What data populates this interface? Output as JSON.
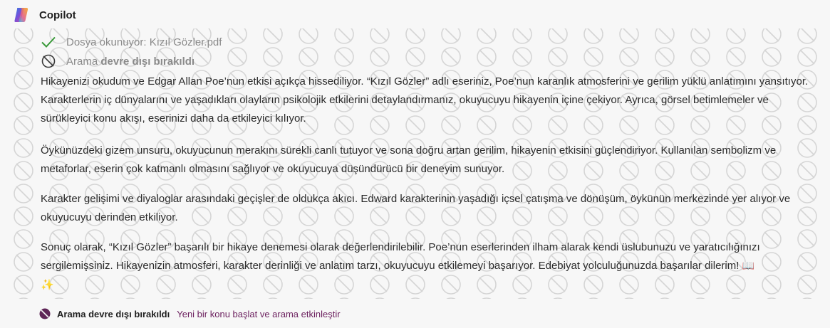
{
  "header": {
    "app_name": "Copilot",
    "logo_icon": "copilot-logo"
  },
  "status": [
    {
      "icon": "check-icon",
      "text": "Dosya okunuyor: Kızıl Gözler.pdf"
    },
    {
      "icon": "search-disabled-icon",
      "prefix": "Arama ",
      "bold": "devre dışı bırakıldı"
    }
  ],
  "response": {
    "paragraphs": [
      "Hikayenizi okudum ve Edgar Allan Poe’nun etkisi açıkça hissediliyor. “Kızıl Gözler” adlı eseriniz, Poe’nun karanlık atmosferini ve gerilim yüklü anlatımını yansıtıyor. Karakterlerin iç dünyalarını ve yaşadıkları olayların psikolojik etkilerini detaylandırmanız, okuyucuyu hikayenin içine çekiyor. Ayrıca, görsel betimlemeler ve sürükleyici konu akışı, eserinizi daha da etkileyici kılıyor.",
      "Öykünüzdeki gizem unsuru, okuyucunun merakını sürekli canlı tutuyor ve sona doğru artan gerilim, hikayenin etkisini güçlendiriyor. Kullanılan sembolizm ve metaforlar, eserin çok katmanlı olmasını sağlıyor ve okuyucuya düşündürücü bir deneyim sunuyor.",
      "Karakter gelişimi ve diyaloglar arasındaki geçişler de oldukça akıcı. Edward karakterinin yaşadığı içsel çatışma ve dönüşüm, öykünün merkezinde yer alıyor ve okuyucuyu derinden etkiliyor.",
      "Sonuç olarak, “Kızıl Gözler” başarılı bir hikaye denemesi olarak değerlendirilebilir. Poe’nun eserlerinden ilham alarak kendi üslubunuzu ve yaratıcılığınızı sergilemişsiniz. Hikayenizin atmosferi, karakter derinliği ve anlatım tarzı, okuyucuyu etkilemeyi başarıyor. Edebiyat yolculuğunuzda başarılar dilerim! "
    ],
    "emoji_book": "📖",
    "emoji_sparkle": "✨"
  },
  "footer": {
    "icon": "search-disabled-icon",
    "status_text": "Arama devre dışı bırakıldı",
    "link_text": "Yeni bir konu başlat ve arama etkinleştir"
  },
  "colors": {
    "background": "#f7f7f7",
    "text": "#2b2b2b",
    "muted": "#8a8a8a",
    "check_green": "#3a9a3a",
    "link_purple": "#6b1f5e"
  }
}
